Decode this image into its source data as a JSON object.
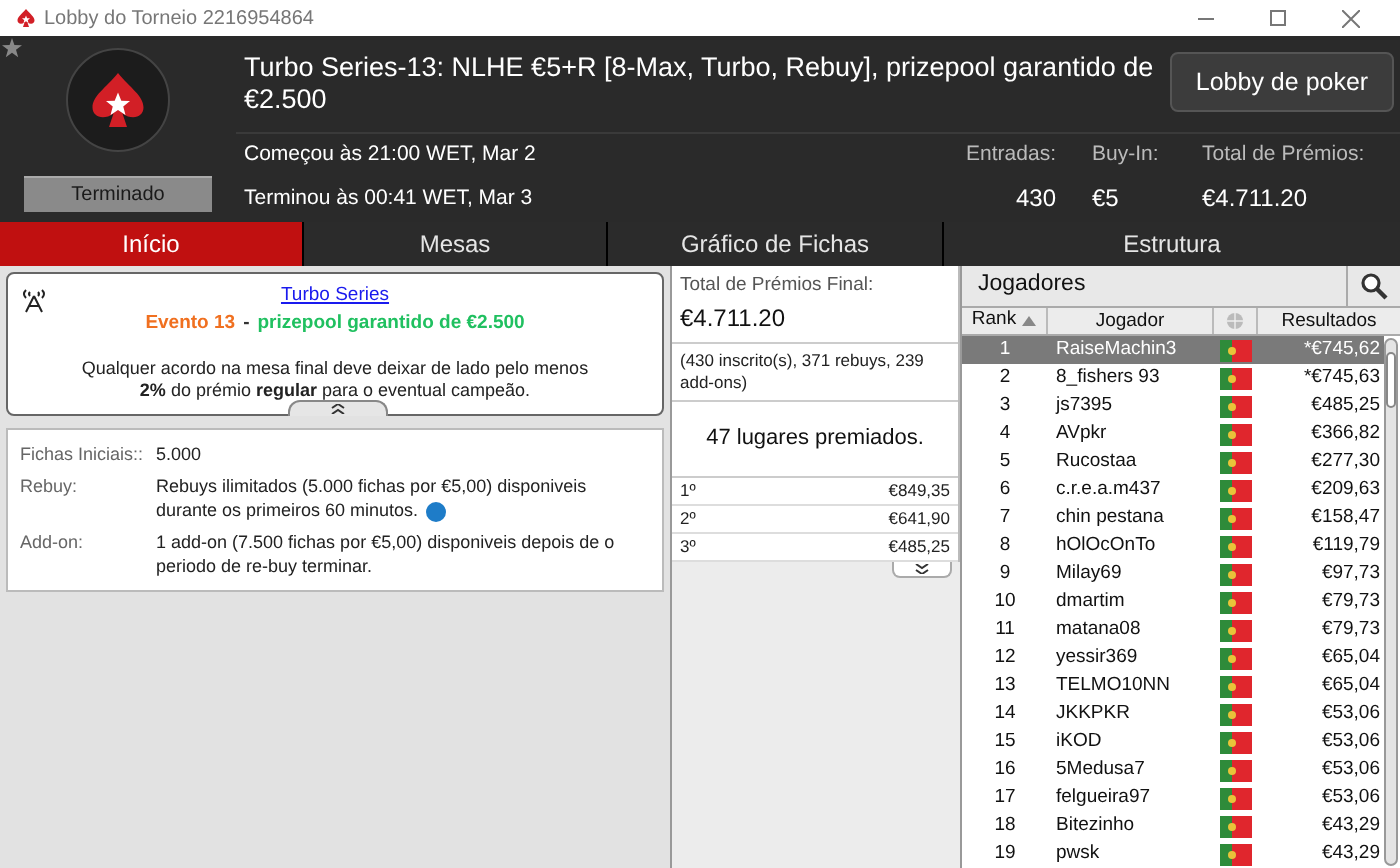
{
  "window": {
    "title": "Lobby do Torneio 2216954864"
  },
  "header": {
    "status": "Terminado",
    "title": "Turbo Series-13: NLHE €5+R [8-Max, Turbo, Rebuy], prizepool garantido de €2.500",
    "lobby_button": "Lobby de poker",
    "started": "Começou às 21:00 WET, Mar 2",
    "ended": "Terminou às 00:41 WET, Mar 3",
    "stats": [
      {
        "label": "Entradas:",
        "value": "430"
      },
      {
        "label": "Buy-In:",
        "value": "€5"
      },
      {
        "label": "Total de Prémios:",
        "value": "€4.711.20"
      }
    ]
  },
  "tabs": [
    {
      "label": "Início",
      "selected": true
    },
    {
      "label": "Mesas",
      "selected": false
    },
    {
      "label": "Gráfico de Fichas",
      "selected": false
    },
    {
      "label": "Estrutura",
      "selected": false
    }
  ],
  "info": {
    "series_link": "Turbo Series",
    "event": "Evento 13",
    "separator": "-",
    "guarantee": "prizepool garantido de €2.500",
    "notice": "Qualquer acordo na mesa final deve deixar de lado pelo menos **2%** do prémio **regular** para o eventual campeão."
  },
  "details": [
    {
      "label": "Fichas Iniciais::",
      "value": "5.000",
      "info": false
    },
    {
      "label": "Rebuy:",
      "value": "Rebuys ilimitados (5.000 fichas por €5,00) disponiveis durante os primeiros 60 minutos.",
      "info": true
    },
    {
      "label": "Add-on:",
      "value": "1 add-on (7.500 fichas por €5,00) disponiveis depois de o periodo de re-buy terminar.",
      "info": false
    }
  ],
  "prizes": {
    "label": "Total de Prémios Final:",
    "total": "€4.711.20",
    "breakdown": "(430 inscrito(s), 371 rebuys, 239 add-ons)",
    "places": "47 lugares premiados.",
    "rows": [
      {
        "place": "1º",
        "amount": "€849,35"
      },
      {
        "place": "2º",
        "amount": "€641,90"
      },
      {
        "place": "3º",
        "amount": "€485,25"
      }
    ]
  },
  "players": {
    "title": "Jogadores",
    "columns": [
      "Rank",
      "Jogador",
      "Resultados"
    ],
    "rows": [
      {
        "rank": "1",
        "name": "RaiseMachin3",
        "result": "*€745,62",
        "selected": true
      },
      {
        "rank": "2",
        "name": "8_fishers 93",
        "result": "*€745,63",
        "selected": false
      },
      {
        "rank": "3",
        "name": "js7395",
        "result": "€485,25",
        "selected": false
      },
      {
        "rank": "4",
        "name": "AVpkr",
        "result": "€366,82",
        "selected": false
      },
      {
        "rank": "5",
        "name": "Rucostaa",
        "result": "€277,30",
        "selected": false
      },
      {
        "rank": "6",
        "name": "c.r.e.a.m437",
        "result": "€209,63",
        "selected": false
      },
      {
        "rank": "7",
        "name": "chin pestana",
        "result": "€158,47",
        "selected": false
      },
      {
        "rank": "8",
        "name": "hOlOcOnTo",
        "result": "€119,79",
        "selected": false
      },
      {
        "rank": "9",
        "name": "Milay69",
        "result": "€97,73",
        "selected": false
      },
      {
        "rank": "10",
        "name": "dmartim",
        "result": "€79,73",
        "selected": false
      },
      {
        "rank": "11",
        "name": "matana08",
        "result": "€79,73",
        "selected": false
      },
      {
        "rank": "12",
        "name": "yessir369",
        "result": "€65,04",
        "selected": false
      },
      {
        "rank": "13",
        "name": "TELMO10NN",
        "result": "€65,04",
        "selected": false
      },
      {
        "rank": "14",
        "name": "JKKPKR",
        "result": "€53,06",
        "selected": false
      },
      {
        "rank": "15",
        "name": "iKOD",
        "result": "€53,06",
        "selected": false
      },
      {
        "rank": "16",
        "name": "5Medusa7",
        "result": "€53,06",
        "selected": false
      },
      {
        "rank": "17",
        "name": "felgueira97",
        "result": "€53,06",
        "selected": false
      },
      {
        "rank": "18",
        "name": "Bitezinho",
        "result": "€43,29",
        "selected": false
      },
      {
        "rank": "19",
        "name": "pwsk",
        "result": "€43,29",
        "selected": false
      }
    ]
  }
}
